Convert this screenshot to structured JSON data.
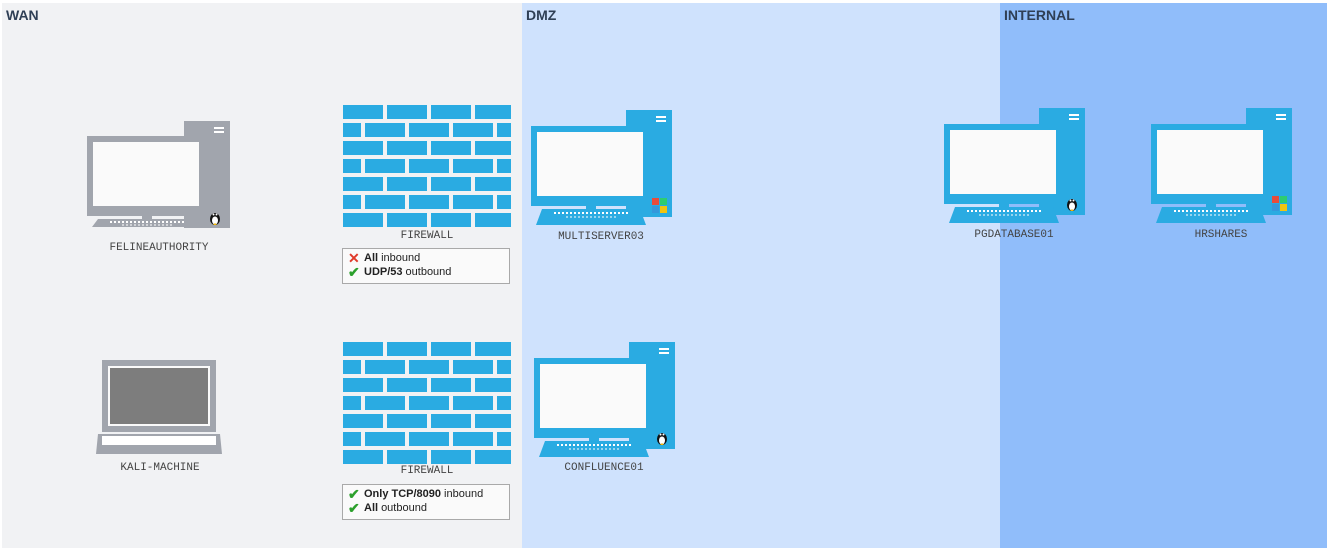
{
  "zones": [
    {
      "id": "wan",
      "label": "WAN",
      "color": "#f1f2f4"
    },
    {
      "id": "dmz",
      "label": "DMZ",
      "color": "#cfe2fd"
    },
    {
      "id": "internal",
      "label": "INTERNAL",
      "color": "#90bdfa"
    }
  ],
  "nodes": {
    "felineauthority": {
      "label": "FELINEAUTHORITY",
      "kind": "desktop",
      "color": "#a1a5ad",
      "os": "linux-icon"
    },
    "kali": {
      "label": "KALI-MACHINE",
      "kind": "laptop",
      "color": "#a1a5ad"
    },
    "firewall1": {
      "label": "FIREWALL",
      "color": "#2aabe2"
    },
    "firewall2": {
      "label": "FIREWALL",
      "color": "#2aabe2"
    },
    "multiserver": {
      "label": "MULTISERVER03",
      "kind": "desktop",
      "color": "#2aabe2",
      "os": "windows-icon"
    },
    "confluence": {
      "label": "CONFLUENCE01",
      "kind": "desktop",
      "color": "#2aabe2",
      "os": "linux-icon"
    },
    "pgdatabase": {
      "label": "PGDATABASE01",
      "kind": "desktop",
      "color": "#2aabe2",
      "os": "linux-icon"
    },
    "hrshares": {
      "label": "HRSHARES",
      "kind": "desktop",
      "color": "#2aabe2",
      "os": "windows-icon"
    }
  },
  "firewall_rules": {
    "fw1": [
      {
        "status": "deny",
        "bold": "All",
        "text": "inbound"
      },
      {
        "status": "allow",
        "bold": "UDP/53",
        "text": "outbound"
      }
    ],
    "fw2": [
      {
        "status": "allow",
        "bold": "Only TCP/8090",
        "text": "inbound"
      },
      {
        "status": "allow",
        "bold": "All",
        "text": "outbound"
      }
    ]
  },
  "icons": {
    "allow": "✔",
    "deny": "✕"
  },
  "colors": {
    "grey_device": "#a1a5ad",
    "blue_device": "#2aabe2",
    "screen": "#fafafa"
  }
}
